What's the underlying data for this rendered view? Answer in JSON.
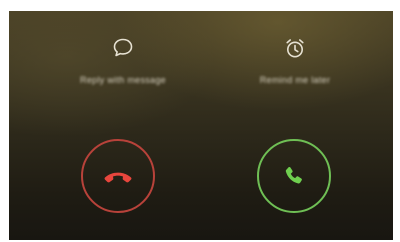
{
  "options": [
    {
      "id": "message",
      "icon": "message-bubble-icon",
      "label": "Reply with message"
    },
    {
      "id": "reminder",
      "icon": "alarm-clock-icon",
      "label": "Remind me later"
    }
  ],
  "actions": {
    "decline": {
      "icon": "phone-hangup-icon",
      "color": "#e8463d",
      "ring_color": "#b8423a"
    },
    "answer": {
      "icon": "phone-answer-icon",
      "color": "#6fcf4f",
      "ring_color": "#6fbf55"
    }
  }
}
